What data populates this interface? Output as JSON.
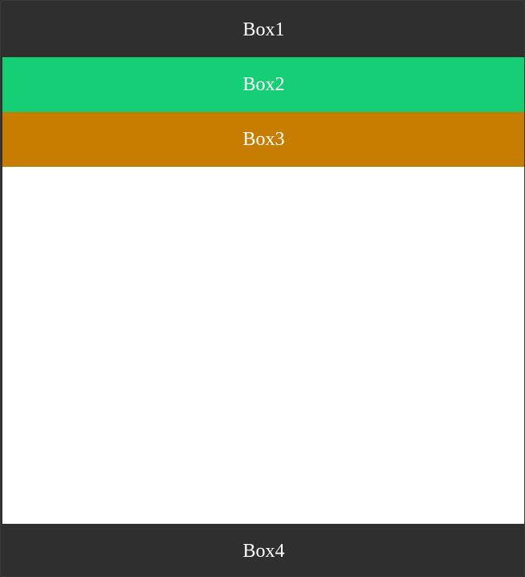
{
  "boxes": {
    "box1": {
      "label": "Box1",
      "color": "#2f2f2f"
    },
    "box2": {
      "label": "Box2",
      "color": "#16cf75"
    },
    "box3": {
      "label": "Box3",
      "color": "#c77e00"
    },
    "box4": {
      "label": "Box4",
      "color": "#2f2f2f"
    }
  },
  "content": {
    "background": "#ffffff"
  },
  "frame": {
    "background": "#2f2f2f"
  }
}
